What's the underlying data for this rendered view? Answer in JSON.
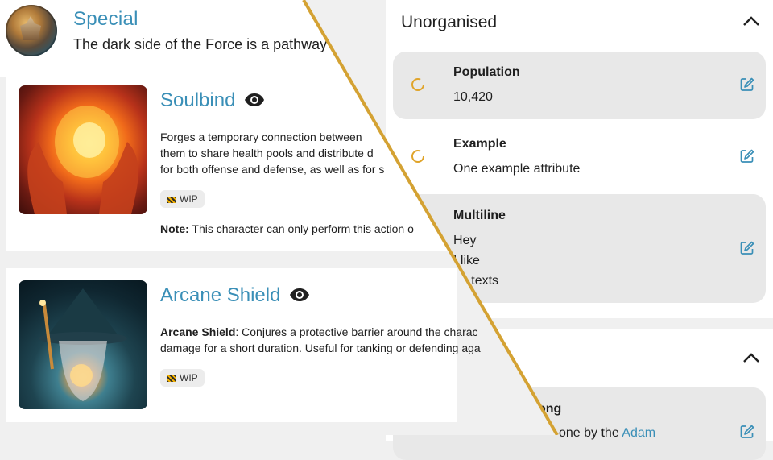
{
  "header": {
    "title": "Special",
    "subtitle": "The dark side of the Force is a pathway"
  },
  "abilities": [
    {
      "title": "Soulbind",
      "description_lines": [
        "Forges a temporary connection between",
        "them to share health pools and distribute d",
        "for both offense and defense, as well as for s"
      ],
      "tag": "WIP",
      "note_label": "Note:",
      "note_text": " This character can only perform this action o"
    },
    {
      "title": "Arcane Shield",
      "description_bold": "Arcane Shield",
      "description_line1": ": Conjures a protective barrier around the charac",
      "description_line2": "damage for a short duration. Useful for tanking or defending aga",
      "tag": "WIP"
    }
  ],
  "attribute_panels": [
    {
      "title": "Unorganised",
      "items": [
        {
          "label": "Population",
          "value_lines": [
            "10,420"
          ]
        },
        {
          "label": "Example",
          "value_lines": [
            "One example attribute"
          ]
        },
        {
          "label": "Multiline",
          "value_lines": [
            "Hey",
            "I like",
            "ng texts"
          ]
        }
      ]
    },
    {
      "title": "",
      "items": [
        {
          "label": "ong",
          "value_prefix": "one by the ",
          "value_link": "Adam"
        }
      ]
    }
  ],
  "colors": {
    "accent": "#3a8fb7",
    "spinner": "#e0a42a",
    "divider": "#d4a233",
    "card": "#ffffff",
    "background": "#f0f0f0",
    "item_shade": "#e8e8e8"
  },
  "icons": {
    "sort": "sort-arrows-icon",
    "visibility": "eye-icon",
    "collapse": "chevron-up-icon",
    "edit": "edit-icon",
    "loading": "spinner-icon",
    "wip": "construction-barrier-icon"
  }
}
